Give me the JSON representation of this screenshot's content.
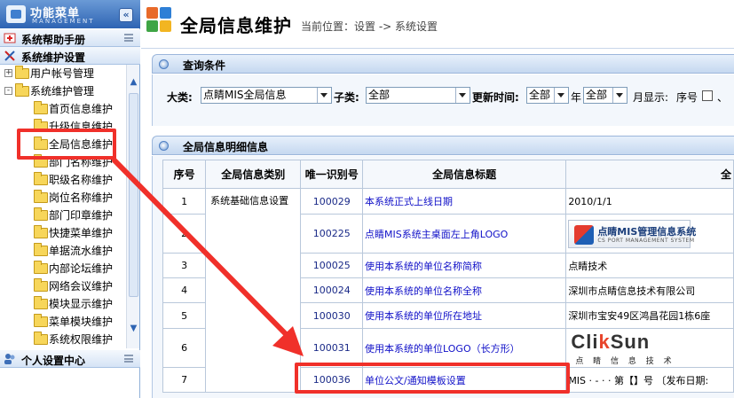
{
  "sidebar": {
    "title": "功能菜单",
    "subtitle": "MANAGEMENT",
    "collapse_glyph": "«",
    "sections": [
      {
        "label": "系统帮助手册"
      },
      {
        "label": "系统维护设置"
      },
      {
        "label": "个人设置中心"
      }
    ],
    "tree": {
      "groups": [
        {
          "label": "用户帐号管理",
          "toggle": "+"
        },
        {
          "label": "系统维护管理",
          "toggle": "-"
        }
      ],
      "items": [
        {
          "label": "首页信息维护"
        },
        {
          "label": "升级信息维护"
        },
        {
          "label": "全局信息维护"
        },
        {
          "label": "部门名称维护"
        },
        {
          "label": "职级名称维护"
        },
        {
          "label": "岗位名称维护"
        },
        {
          "label": "部门印章维护"
        },
        {
          "label": "快捷菜单维护"
        },
        {
          "label": "单据流水维护"
        },
        {
          "label": "内部论坛维护"
        },
        {
          "label": "网络会议维护"
        },
        {
          "label": "模块显示维护"
        },
        {
          "label": "菜单模块维护"
        },
        {
          "label": "系统权限维护"
        }
      ]
    }
  },
  "header": {
    "title": "全局信息维护",
    "breadcrumb": "当前位置：设置 -> 系统设置"
  },
  "query": {
    "title": "查询条件",
    "category_label": "大类:",
    "category_value": "点睛MIS全局信息",
    "subcategory_label": "子类:",
    "subcategory_value": "全部",
    "update_time_label": "更新时间:",
    "year_value": "全部",
    "year_unit": "年",
    "month_value": "全部",
    "month_unit": "月显示:",
    "serial_label": "序号",
    "trailing": "、"
  },
  "detail": {
    "title": "全局信息明细信息",
    "columns": [
      "序号",
      "全局信息类别",
      "唯一识别号",
      "全局信息标题",
      "全"
    ],
    "category_group": "系统基础信息设置",
    "rows": [
      {
        "no": "1",
        "id": "100029",
        "title": "本系统正式上线日期",
        "value": "2010/1/1"
      },
      {
        "no": "2",
        "id": "100225",
        "title": "点睛MIS系统主桌面左上角LOGO",
        "value": ""
      },
      {
        "no": "3",
        "id": "100025",
        "title": "使用本系统的单位名称简称",
        "value": "点睛技术"
      },
      {
        "no": "4",
        "id": "100024",
        "title": "使用本系统的单位名称全称",
        "value": "深圳市点睛信息技术有限公司"
      },
      {
        "no": "5",
        "id": "100030",
        "title": "使用本系统的单位所在地址",
        "value": "深圳市宝安49区鸿昌花园1栋6座"
      },
      {
        "no": "6",
        "id": "100031",
        "title": "使用本系统的单位LOGO（长方形）",
        "value": ""
      },
      {
        "no": "7",
        "id": "100036",
        "title": "单位公文/通知模板设置",
        "value": "MIS · - · · 第【】号 〔发布日期:"
      }
    ],
    "logo_mis": {
      "text": "点睛MIS管理信息系统",
      "sub": "CS PORT MANAGEMENT SYSTEM"
    },
    "logo_cs": {
      "brand_pre": "Cli",
      "brand_accent": "k",
      "brand_post": "Sun",
      "slogan": "点 睛 信 息 技 术"
    }
  },
  "colors": {
    "highlight": "#f0302a",
    "link": "#1010c8",
    "header_blue": "#2e64b3"
  }
}
